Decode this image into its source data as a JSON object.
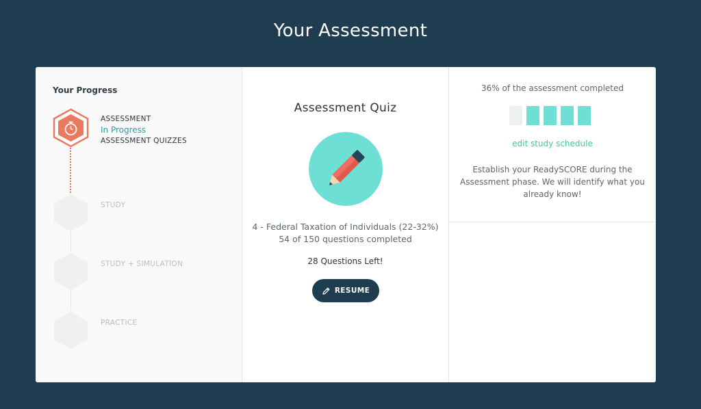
{
  "page": {
    "title": "Your Assessment"
  },
  "progress": {
    "title": "Your Progress",
    "steps": [
      {
        "name": "ASSESSMENT",
        "status": "In Progress",
        "sub": "ASSESSMENT QUIZZES",
        "icon": "stopwatch-icon",
        "state": "active"
      },
      {
        "name": "STUDY",
        "state": "locked"
      },
      {
        "name": "STUDY + SIMULATION",
        "state": "locked"
      },
      {
        "name": "PRACTICE",
        "state": "locked"
      }
    ]
  },
  "quiz": {
    "title": "Assessment Quiz",
    "icon": "pencil-icon",
    "topic": "4 - Federal Taxation of Individuals (22-32%)",
    "completed_text": "54 of 150 questions completed",
    "questions_completed": 54,
    "questions_total": 150,
    "left_text": "28 Questions Left!",
    "resume_label": "RESUME"
  },
  "summary": {
    "percent_text": "36% of the assessment completed",
    "percent": 36,
    "blocks": [
      false,
      true,
      true,
      true,
      true
    ],
    "edit_link": "edit study schedule",
    "description": "Establish your ReadySCORE during the Assessment phase. We will identify what you already know!"
  },
  "colors": {
    "background": "#1e3d50",
    "accent_orange": "#e97a5f",
    "accent_teal": "#6edfd4",
    "status_green": "#2aa198",
    "link_green": "#3dc9a2"
  }
}
